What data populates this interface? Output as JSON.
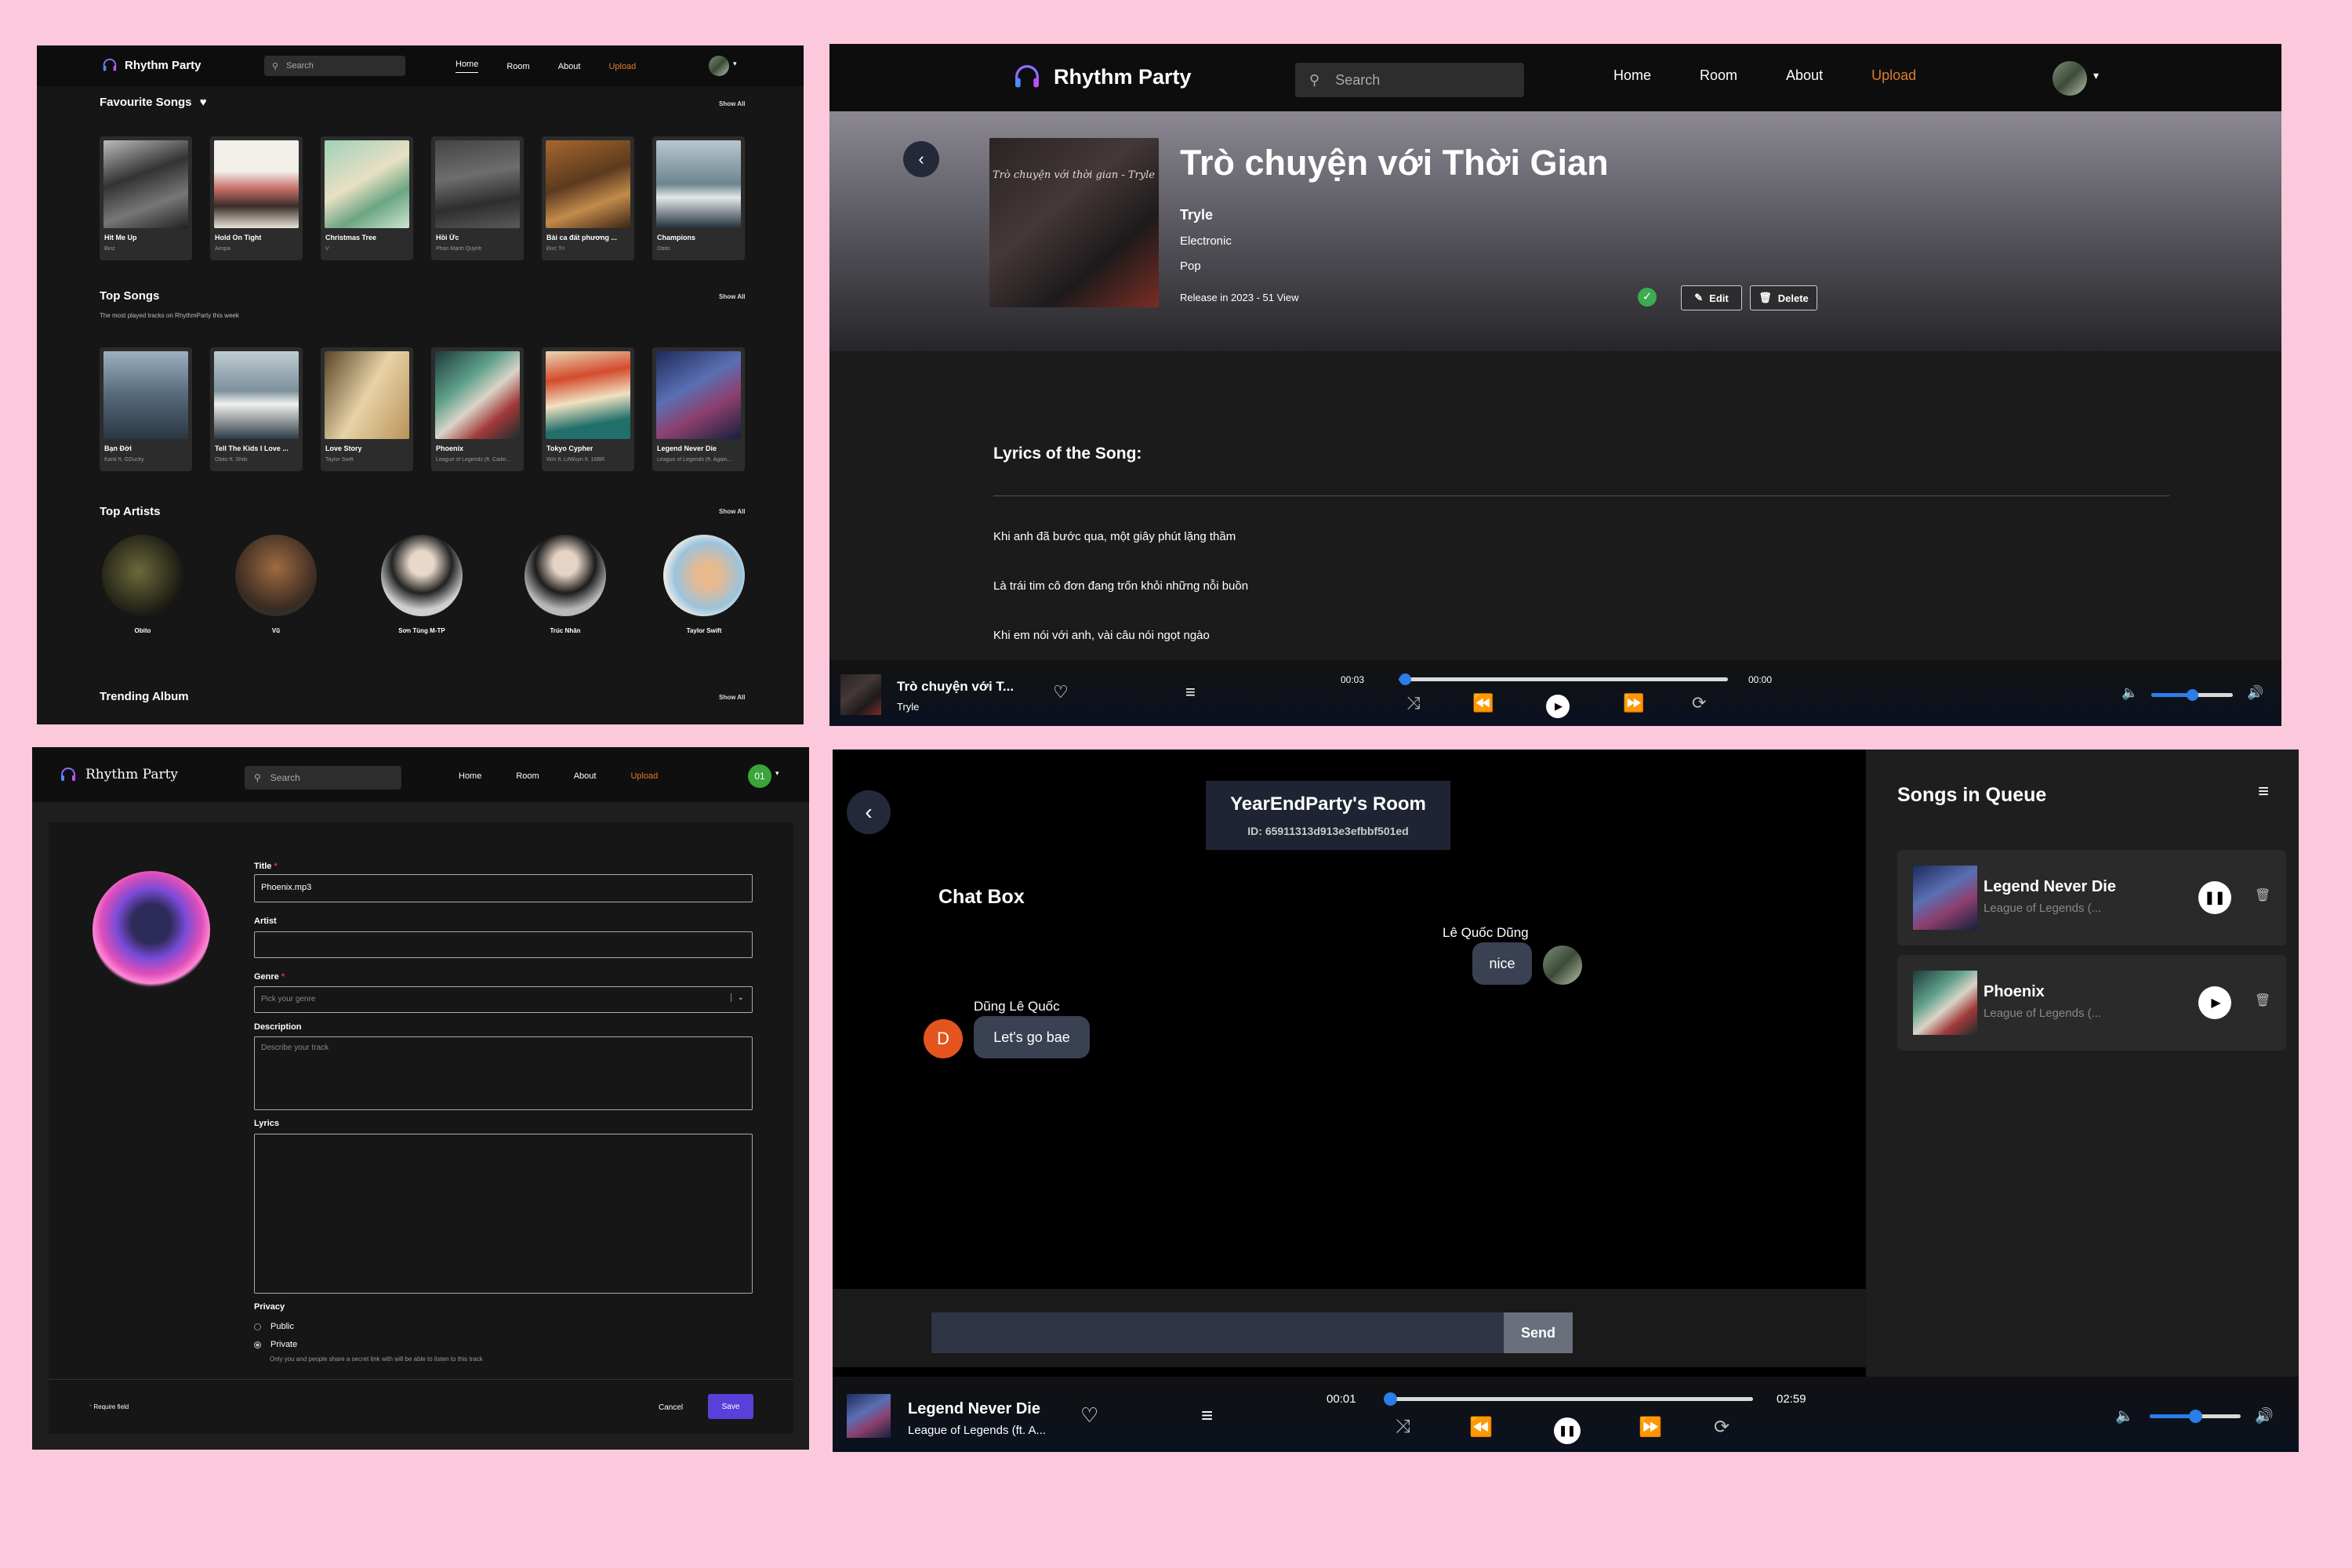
{
  "app": {
    "name": "Rhythm Party",
    "search_placeholder": "Search"
  },
  "nav": {
    "home": "Home",
    "room": "Room",
    "about": "About",
    "upload": "Upload"
  },
  "colors": {
    "bg_pink": "#fcc9dc",
    "accent_orange": "#e07b2e",
    "slider_blue": "#2b7de9",
    "save_purple": "#5b3fd9"
  },
  "home": {
    "favourite_title": "Favourite Songs",
    "top_songs_title": "Top Songs",
    "top_songs_subtitle": "The most played tracks on RhythmParty this week",
    "top_artists_title": "Top Artists",
    "trending_album_title": "Trending Album",
    "show_all": "Show All",
    "favourite": [
      {
        "title": "Hit Me Up",
        "artist": "Binz"
      },
      {
        "title": "Hold On Tight",
        "artist": "Aespa"
      },
      {
        "title": "Christmas Tree",
        "artist": "V"
      },
      {
        "title": "Hồi Ức",
        "artist": "Phan Mạnh Quỳnh"
      },
      {
        "title": "Bài ca đất phương ...",
        "artist": "Đức Trí"
      },
      {
        "title": "Champions",
        "artist": "Obito"
      }
    ],
    "top": [
      {
        "title": "Bạn Đời",
        "artist": "Karik ft. GDucky"
      },
      {
        "title": "Tell The Kids I Love ...",
        "artist": "Obito ft. Shiki"
      },
      {
        "title": "Love Story",
        "artist": "Taylor Swift"
      },
      {
        "title": "Phoenix",
        "artist": "League of Legends (ft. Cailin..."
      },
      {
        "title": "Tokyo Cypher",
        "artist": "W/n ft. LilWuyn ft. 16BR"
      },
      {
        "title": "Legend Never Die",
        "artist": "League of Legends (ft. Again..."
      }
    ],
    "artists": [
      "Obito",
      "Vũ",
      "Sơn Tùng M-TP",
      "Trúc Nhân",
      "Taylor Swift"
    ]
  },
  "song_detail": {
    "title": "Trò chuyện với Thời Gian",
    "cover_text": "Trò chuyện với thời gian - Tryle",
    "artist": "Tryle",
    "genre1": "Electronic",
    "genre2": "Pop",
    "release": "Release in 2023 - 51 View",
    "edit": "Edit",
    "delete": "Delete",
    "lyrics_title": "Lyrics of the Song:",
    "lyrics": [
      "Khi anh đã bước qua, một giây phút lặng thầm",
      "Là trái tim cô đơn đang trốn khỏi những nỗi buồn",
      "Khi em nói với anh, vài câu nói ngọt ngào"
    ],
    "player": {
      "title": "Trò chuyện với T...",
      "artist": "Tryle",
      "elapsed": "00:03",
      "total": "00:00",
      "progress": 0.02,
      "volume": 0.5
    }
  },
  "upload_form": {
    "avatar_text": "01",
    "title_label": "Title",
    "title_value": "Phoenix.mp3",
    "artist_label": "Artist",
    "genre_label": "Genre",
    "genre_placeholder": "Pick your genre",
    "description_label": "Description",
    "description_placeholder": "Describe your track",
    "lyrics_label": "Lyrics",
    "privacy_label": "Privacy",
    "public": "Public",
    "private": "Private",
    "private_note": "Only you and people share a secret link with will be able to listen to this track",
    "required_note": "Require field",
    "cancel": "Cancel",
    "save": "Save"
  },
  "room": {
    "name": "YearEndParty's Room",
    "id": "ID: 65911313d913e3efbbf501ed",
    "chat_title": "Chat Box",
    "messages": [
      {
        "sender": "Lê Quốc Dũng",
        "text": "nice"
      },
      {
        "sender": "Dũng Lê Quốc",
        "initial": "D",
        "text": "Let's go bae"
      }
    ],
    "send": "Send",
    "queue_title": "Songs in Queue",
    "queue": [
      {
        "title": "Legend Never Die",
        "artist": "League of Legends (..."
      },
      {
        "title": "Phoenix",
        "artist": "League of Legends (..."
      }
    ],
    "player": {
      "title": "Legend Never Die",
      "artist": "League of Legends (ft. A...",
      "elapsed": "00:01",
      "total": "02:59",
      "progress": 0.01,
      "volume": 0.5
    }
  }
}
